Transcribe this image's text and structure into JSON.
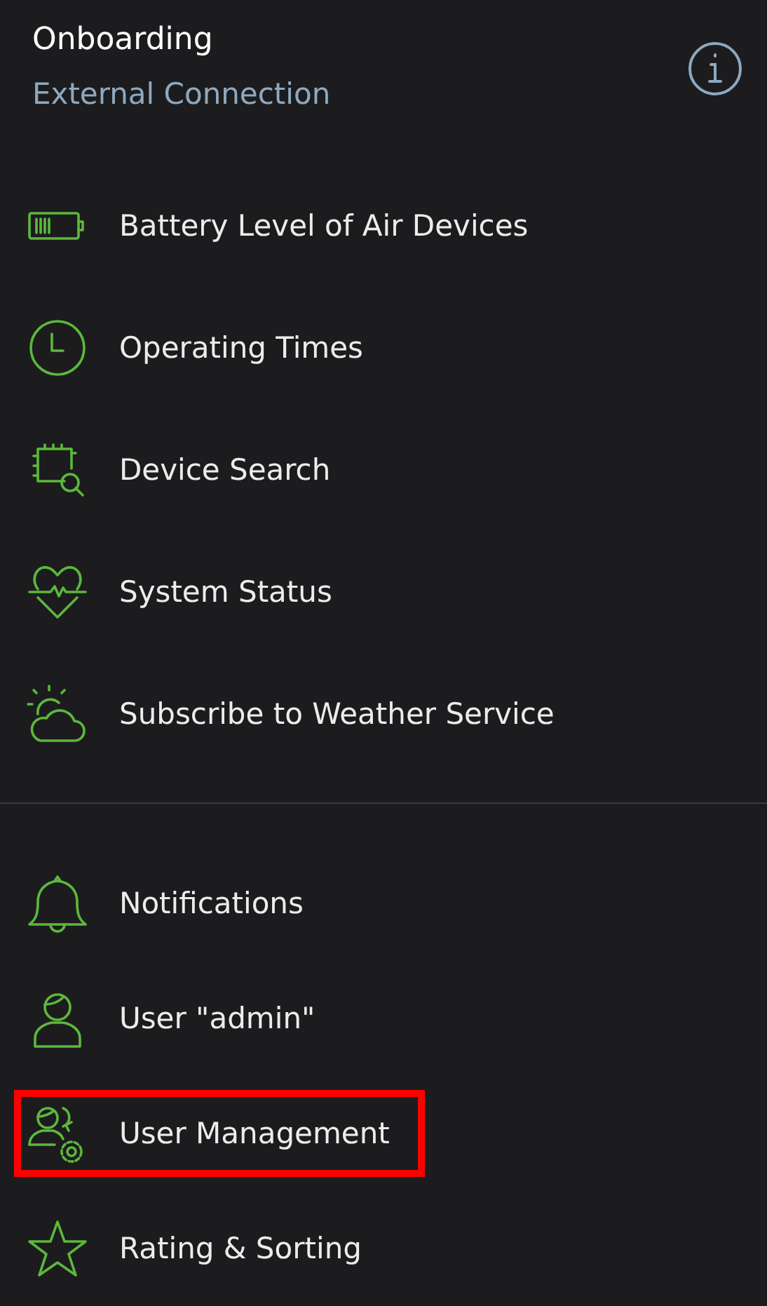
{
  "header": {
    "title": "Onboarding",
    "subtitle": "External Connection"
  },
  "sections": [
    {
      "items": [
        {
          "label": "Battery Level of Air Devices",
          "highlighted": false
        },
        {
          "label": "Operating Times",
          "highlighted": false
        },
        {
          "label": "Device Search",
          "highlighted": false
        },
        {
          "label": "System Status",
          "highlighted": false
        },
        {
          "label": "Subscribe to Weather Service",
          "highlighted": false
        }
      ]
    },
    {
      "items": [
        {
          "label": "Notifications",
          "highlighted": false
        },
        {
          "label": "User \"admin\"",
          "highlighted": false
        },
        {
          "label": "User Management",
          "highlighted": true
        },
        {
          "label": "Rating & Sorting",
          "highlighted": false
        }
      ]
    }
  ]
}
